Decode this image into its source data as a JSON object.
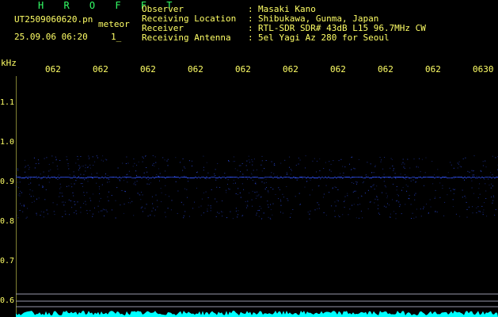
{
  "header": {
    "software": "H R O F F T",
    "filename": "UT2509060620.pn",
    "tag": "meteor",
    "datetime": "25.09.06 06:20",
    "channel": "1_",
    "fields": [
      {
        "label": "Observer",
        "value": "Masaki Kano"
      },
      {
        "label": "Receiving Location",
        "value": "Shibukawa, Gunma, Japan"
      },
      {
        "label": "Receiver",
        "value": "RTL-SDR SDR# 43dB L15 96.7MHz CW"
      },
      {
        "label": "Receiving Antenna",
        "value": "5el Yagi Az 280 for Seoul"
      }
    ]
  },
  "axis": {
    "unit": "kHz",
    "time_labels": [
      "062",
      "062",
      "062",
      "062",
      "062",
      "062",
      "062",
      "062",
      "062",
      "0630"
    ],
    "freq_labels": [
      "1.1",
      "1.0",
      "0.9",
      "0.8",
      "0.7",
      "0.6"
    ]
  },
  "colors": {
    "text": "#ffff66",
    "title": "#33ff66",
    "signal": "#3355ff",
    "noise": "#00ffff"
  }
}
